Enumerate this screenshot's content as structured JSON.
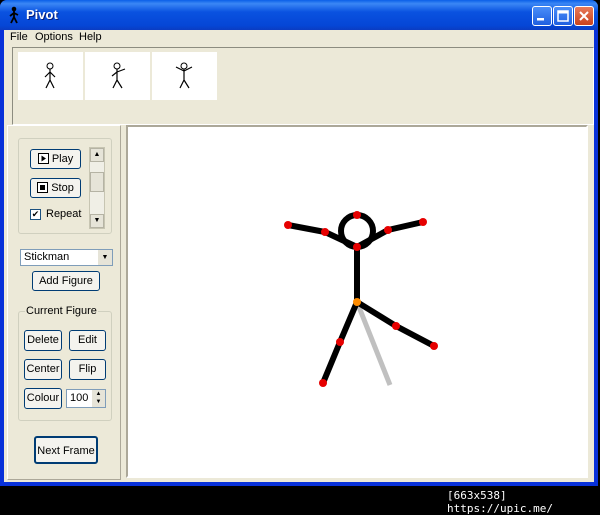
{
  "window": {
    "title": "Pivot"
  },
  "menu": [
    "File",
    "Options",
    "Help"
  ],
  "playback": {
    "play_label": "Play",
    "stop_label": "Stop",
    "repeat_label": "Repeat",
    "repeat_checked": true
  },
  "figure_select": {
    "selected": "Stickman"
  },
  "add_figure_label": "Add Figure",
  "current_figure": {
    "group_label": "Current Figure",
    "delete_label": "Delete",
    "edit_label": "Edit",
    "center_label": "Center",
    "flip_label": "Flip",
    "colour_label": "Colour",
    "size_value": "100"
  },
  "next_frame_label": "Next Frame",
  "footer": "[663x538] https://upic.me/",
  "colors": {
    "joint": "#e60000",
    "origin_joint": "#ff8c00",
    "previous_frame": "#bfbfbf"
  }
}
